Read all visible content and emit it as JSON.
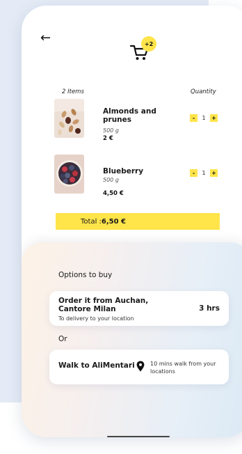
{
  "header": {
    "back_icon": "arrow-left-icon",
    "cart_icon": "cart-icon",
    "cart_badge": "+2"
  },
  "cart": {
    "items_count_label": "2 Items",
    "quantity_label": "Quantity",
    "items": [
      {
        "name": "Almonds and prunes",
        "weight": "500 g",
        "price": "2 €",
        "quantity": "1",
        "minus_label": "-",
        "plus_label": "+"
      },
      {
        "name": "Blueberry",
        "weight": "500 g",
        "price": "4,50 €",
        "quantity": "1",
        "minus_label": "-",
        "plus_label": "+"
      }
    ],
    "total_label": "Total : ",
    "total_value": "6,50 €"
  },
  "options": {
    "title": "Options to buy",
    "order_option": {
      "title": "Order it from Auchan, Cantore Milan",
      "subtitle": "To delivery to your location",
      "time": "3 hrs"
    },
    "or_label": "Or",
    "walk_option": {
      "title": "Walk to AliMentari",
      "pin_icon": "location-pin-icon",
      "detail": "10 mins walk from your locations"
    }
  },
  "colors": {
    "accent": "#ffe44a",
    "background_panel": "#e4ebf6"
  }
}
